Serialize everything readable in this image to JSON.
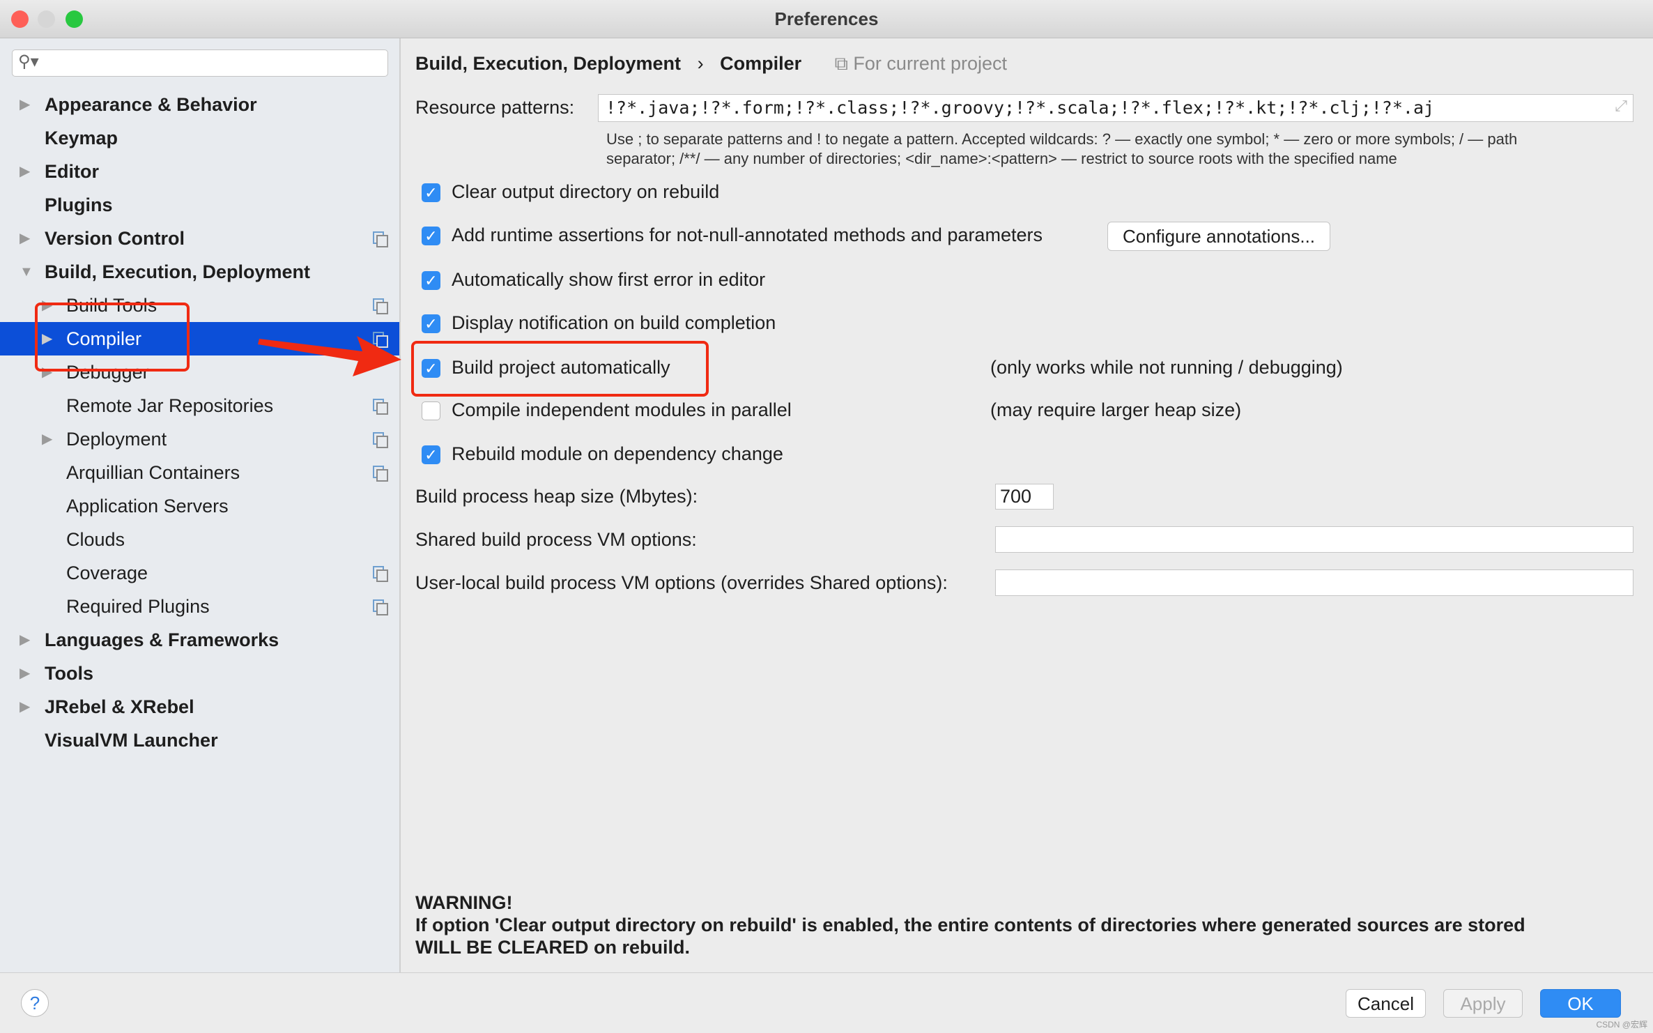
{
  "window": {
    "title": "Preferences"
  },
  "sidebar": {
    "search_placeholder": "",
    "items": [
      {
        "label": "Appearance & Behavior",
        "level": 0,
        "arrow": "right",
        "copy": false
      },
      {
        "label": "Keymap",
        "level": 0,
        "arrow": "",
        "copy": false
      },
      {
        "label": "Editor",
        "level": 0,
        "arrow": "right",
        "copy": false
      },
      {
        "label": "Plugins",
        "level": 0,
        "arrow": "",
        "copy": false
      },
      {
        "label": "Version Control",
        "level": 0,
        "arrow": "right",
        "copy": true
      },
      {
        "label": "Build, Execution, Deployment",
        "level": 0,
        "arrow": "down",
        "copy": false
      },
      {
        "label": "Build Tools",
        "level": 1,
        "arrow": "right",
        "copy": true
      },
      {
        "label": "Compiler",
        "level": 1,
        "arrow": "right",
        "copy": true,
        "selected": true
      },
      {
        "label": "Debugger",
        "level": 1,
        "arrow": "right",
        "copy": false
      },
      {
        "label": "Remote Jar Repositories",
        "level": 1,
        "arrow": "",
        "copy": true
      },
      {
        "label": "Deployment",
        "level": 1,
        "arrow": "right",
        "copy": true
      },
      {
        "label": "Arquillian Containers",
        "level": 1,
        "arrow": "",
        "copy": true
      },
      {
        "label": "Application Servers",
        "level": 1,
        "arrow": "",
        "copy": false
      },
      {
        "label": "Clouds",
        "level": 1,
        "arrow": "",
        "copy": false
      },
      {
        "label": "Coverage",
        "level": 1,
        "arrow": "",
        "copy": true
      },
      {
        "label": "Required Plugins",
        "level": 1,
        "arrow": "",
        "copy": true
      },
      {
        "label": "Languages & Frameworks",
        "level": 0,
        "arrow": "right",
        "copy": false
      },
      {
        "label": "Tools",
        "level": 0,
        "arrow": "right",
        "copy": false
      },
      {
        "label": "JRebel & XRebel",
        "level": 0,
        "arrow": "right",
        "copy": false
      },
      {
        "label": "VisualVM Launcher",
        "level": 0,
        "arrow": "",
        "copy": false
      }
    ]
  },
  "breadcrumb": {
    "parent": "Build, Execution, Deployment",
    "sep": "›",
    "current": "Compiler",
    "scope": "For current project"
  },
  "resource": {
    "label": "Resource patterns:",
    "value": "!?*.java;!?*.form;!?*.class;!?*.groovy;!?*.scala;!?*.flex;!?*.kt;!?*.clj;!?*.aj",
    "help1": "Use ; to separate patterns and ! to negate a pattern. Accepted wildcards: ? — exactly one symbol; * — zero or more symbols; / — path",
    "help2": "separator; /**/ — any number of directories; <dir_name>:<pattern> — restrict to source roots with the specified name"
  },
  "options": [
    {
      "label": "Clear output directory on rebuild",
      "checked": true,
      "hint": ""
    },
    {
      "label": "Add runtime assertions for not-null-annotated methods and parameters",
      "checked": true,
      "hint": ""
    },
    {
      "label": "Automatically show first error in editor",
      "checked": true,
      "hint": ""
    },
    {
      "label": "Display notification on build completion",
      "checked": true,
      "hint": ""
    },
    {
      "label": "Build project automatically",
      "checked": true,
      "hint": "(only works while not running / debugging)"
    },
    {
      "label": "Compile independent modules in parallel",
      "checked": false,
      "hint": "(may require larger heap size)"
    },
    {
      "label": "Rebuild module on dependency change",
      "checked": true,
      "hint": ""
    }
  ],
  "configure_button": "Configure annotations...",
  "heap": {
    "label": "Build process heap size (Mbytes):",
    "value": "700"
  },
  "shared_vm": {
    "label": "Shared build process VM options:",
    "value": ""
  },
  "user_vm": {
    "label": "User-local build process VM options (overrides Shared options):",
    "value": ""
  },
  "warning": {
    "title": "WARNING!",
    "line1": "If option 'Clear output directory on rebuild' is enabled, the entire contents of directories where generated sources are stored",
    "line2": "WILL BE CLEARED on rebuild."
  },
  "footer": {
    "help": "?",
    "cancel": "Cancel",
    "apply": "Apply",
    "ok": "OK"
  },
  "watermark": "CSDN @宏辉",
  "colors": {
    "selection": "#0c4fd8",
    "checkbox": "#2f8cf4",
    "annotation": "#f02a12",
    "ok": "#2f8cf4"
  }
}
